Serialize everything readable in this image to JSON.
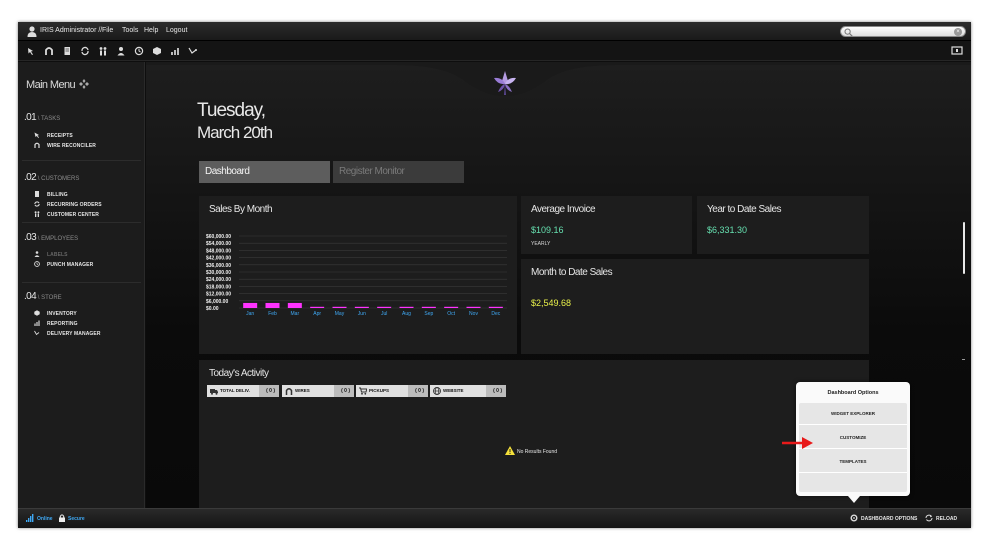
{
  "menubar": {
    "user": "IRIS Administrator //",
    "items": [
      "File",
      "Tools",
      "Help",
      "Logout"
    ],
    "search_placeholder": ""
  },
  "sidebar": {
    "main_menu": "Main Menu",
    "sections": [
      {
        "num": ".01",
        "label": "\\ TASKS",
        "items": [
          {
            "label": "RECEIPTS",
            "icon": "cursor-icon"
          },
          {
            "label": "WIRE RECONCILER",
            "icon": "horseshoe-icon"
          }
        ]
      },
      {
        "num": ".02",
        "label": "\\ CUSTOMERS",
        "items": [
          {
            "label": "BILLING",
            "icon": "document-icon"
          },
          {
            "label": "RECURRING ORDERS",
            "icon": "recurring-icon"
          },
          {
            "label": "CUSTOMER CENTER",
            "icon": "people-icon"
          }
        ]
      },
      {
        "num": ".03",
        "label": "\\ EMPLOYEES",
        "items": [
          {
            "label": "LABELS",
            "icon": "person-icon",
            "disabled": true
          },
          {
            "label": "PUNCH MANAGER",
            "icon": "clock-icon"
          }
        ]
      },
      {
        "num": ".04",
        "label": "\\ STORE",
        "items": [
          {
            "label": "INVENTORY",
            "icon": "box-icon"
          },
          {
            "label": "REPORTING",
            "icon": "chart-icon"
          },
          {
            "label": "DELIVERY MANAGER",
            "icon": "delivery-icon"
          }
        ]
      }
    ]
  },
  "main": {
    "day": "Tuesday,",
    "date": "March 20th",
    "tabs": [
      "Dashboard",
      "Register Monitor"
    ],
    "sales_by_month": {
      "title": "Sales By Month"
    },
    "average_invoice": {
      "title": "Average Invoice",
      "value": "$109.16",
      "sub": "YEARLY"
    },
    "ytd_sales": {
      "title": "Year to Date Sales",
      "value": "$6,331.30"
    },
    "mtd_sales": {
      "title": "Month to Date Sales",
      "value": "$2,549.68"
    },
    "activity": {
      "title": "Today's Activity",
      "groups": [
        {
          "label": "TOTAL DELIV.",
          "count": "( 0 )"
        },
        {
          "label": "WIRES",
          "count": "( 0 )"
        },
        {
          "label": "PICKUPS",
          "count": "( 0 )"
        },
        {
          "label": "WEBSITE",
          "count": "( 0 )"
        }
      ],
      "no_results": "No Results Found"
    }
  },
  "popup": {
    "title": "Dashboard Options",
    "buttons": [
      "WIDGET EXPLORER",
      "CUSTOMIZE",
      "TEMPLATES"
    ]
  },
  "statusbar": {
    "online": "Online",
    "secure": "Secure",
    "dashboard_options": "DASHBOARD OPTIONS",
    "reload": "RELOAD"
  },
  "colors": {
    "value_green": "#66e0b0",
    "value_yellow": "#e8f04a",
    "bar_magenta": "#ff33ff",
    "link_blue": "#3fa9f5"
  },
  "chart_data": {
    "type": "bar",
    "title": "Sales By Month",
    "categories": [
      "Jan",
      "Feb",
      "Mar",
      "Apr",
      "May",
      "Jun",
      "Jul",
      "Aug",
      "Sep",
      "Oct",
      "Nov",
      "Dec"
    ],
    "values": [
      4200,
      4200,
      4200,
      0,
      0,
      0,
      0,
      0,
      0,
      0,
      0,
      0
    ],
    "yticks": [
      "$60,000.00",
      "$54,000.00",
      "$48,000.00",
      "$42,000.00",
      "$36,000.00",
      "$30,000.00",
      "$24,000.00",
      "$18,000.00",
      "$12,000.00",
      "$6,000.00",
      "$0.00"
    ],
    "ylim": [
      0,
      60000
    ],
    "grid": true
  }
}
